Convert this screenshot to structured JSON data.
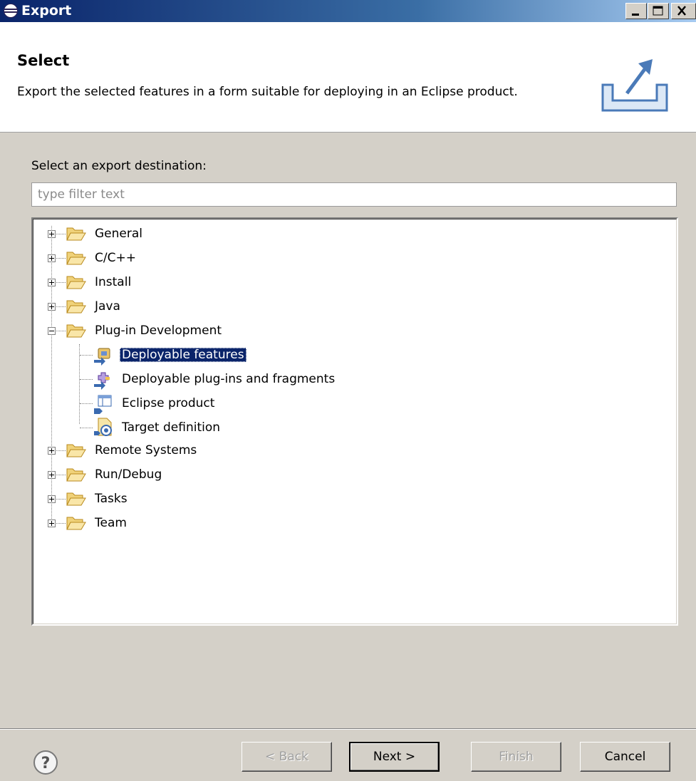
{
  "window": {
    "title": "Export",
    "controls": [
      "minimize-icon",
      "maximize-icon",
      "close-icon"
    ]
  },
  "banner": {
    "heading": "Select",
    "description": "Export the selected features in a form suitable for deploying in an Eclipse product.",
    "icon": "export-icon"
  },
  "destination": {
    "label": "Select an export destination:",
    "filter_placeholder": "type filter text",
    "filter_value": ""
  },
  "tree": {
    "general": "General",
    "cpp": "C/C++",
    "install": "Install",
    "java": "Java",
    "plugin_dev": "Plug-in Development",
    "deployable_features": "Deployable features",
    "deployable_plugins": "Deployable plug-ins and fragments",
    "eclipse_product": "Eclipse product",
    "target_definition": "Target definition",
    "remote_systems": "Remote Systems",
    "run_debug": "Run/Debug",
    "tasks": "Tasks",
    "team": "Team",
    "selected": "Deployable features"
  },
  "buttons": {
    "back": "< Back",
    "next": "Next >",
    "finish": "Finish",
    "cancel": "Cancel"
  },
  "colors": {
    "selection": "#0a246a",
    "title_bar": "#0a246a",
    "dialog_bg": "#d4d0c8"
  }
}
